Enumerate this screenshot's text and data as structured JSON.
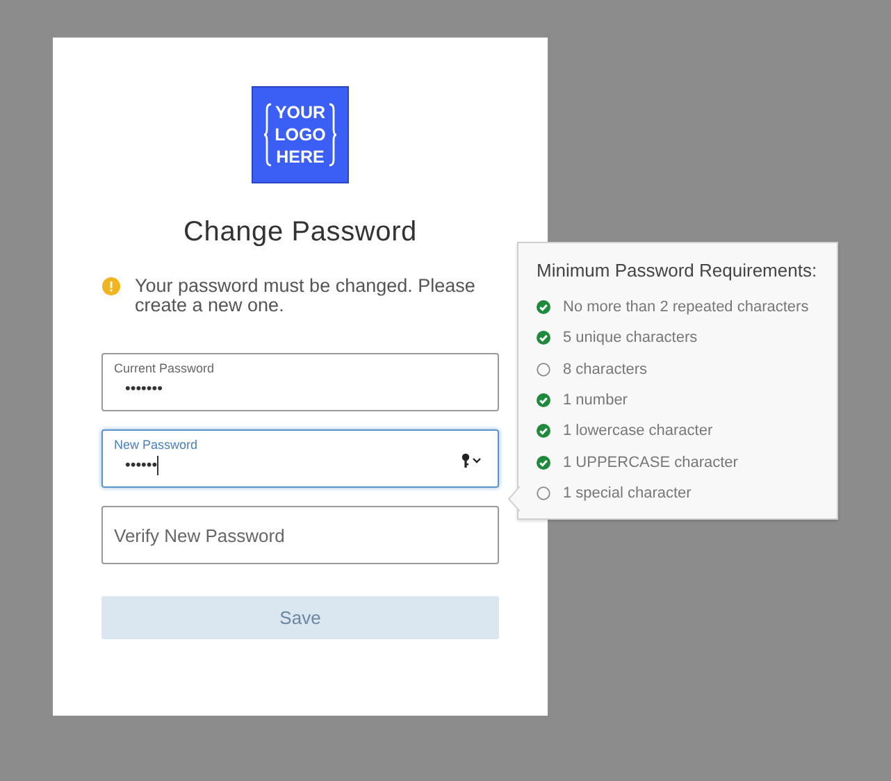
{
  "logo": {
    "lines": [
      "YOUR",
      "LOGO",
      "HERE"
    ]
  },
  "title": "Change Password",
  "notice": "Your password must be changed. Please create a new one.",
  "fields": [
    {
      "label": "Current Password",
      "value": "•••••••",
      "focused": false
    },
    {
      "label": "New Password",
      "value": "••••••",
      "focused": true
    },
    {
      "placeholder": "Verify New Password",
      "focused": false
    }
  ],
  "save_button": {
    "label": "Save",
    "disabled": true
  },
  "requirements": {
    "title": "Minimum Password Requirements:",
    "items": [
      {
        "text": "No more than 2 repeated characters",
        "met": true
      },
      {
        "text": "5 unique characters",
        "met": true
      },
      {
        "text": "8 characters",
        "met": false
      },
      {
        "text": "1 number",
        "met": true
      },
      {
        "text": "1 lowercase character",
        "met": true
      },
      {
        "text": "1 UPPERCASE character",
        "met": true
      },
      {
        "text": "1 special character",
        "met": false
      }
    ]
  }
}
